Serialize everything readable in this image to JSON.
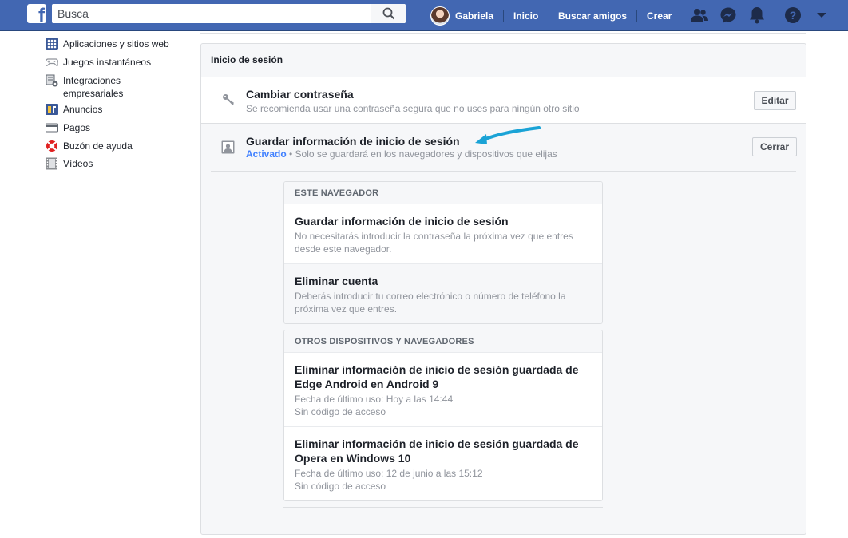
{
  "topbar": {
    "search_placeholder": "Busca",
    "user_name": "Gabriela",
    "nav_home": "Inicio",
    "nav_find_friends": "Buscar amigos",
    "nav_create": "Crear",
    "icons": [
      "friend-requests-icon",
      "messenger-icon",
      "notifications-icon",
      "help-icon",
      "account-menu-icon"
    ]
  },
  "sidebar": {
    "items": [
      {
        "label": "Aplicaciones y sitios web",
        "icon": "apps-icon"
      },
      {
        "label": "Juegos instantáneos",
        "icon": "gamepad-icon"
      },
      {
        "label": "Integraciones empresariales",
        "icon": "business-integrations-icon"
      },
      {
        "label": "Anuncios",
        "icon": "ads-icon"
      },
      {
        "label": "Pagos",
        "icon": "payments-icon"
      },
      {
        "label": "Buzón de ayuda",
        "icon": "support-inbox-icon"
      },
      {
        "label": "Vídeos",
        "icon": "videos-icon"
      }
    ]
  },
  "login_section": {
    "title": "Inicio de sesión",
    "change_password": {
      "title": "Cambiar contraseña",
      "subtitle": "Se recomienda usar una contraseña segura que no uses para ningún otro sitio",
      "button": "Editar"
    },
    "save_login": {
      "title": "Guardar información de inicio de sesión",
      "status": "Activado",
      "subtitle": " • Solo se guardará en los navegadores y dispositivos que elijas",
      "button": "Cerrar"
    },
    "this_browser": {
      "header": "ESTE NAVEGADOR",
      "items": [
        {
          "title": "Guardar información de inicio de sesión",
          "desc": "No necesitarás introducir la contraseña la próxima vez que entres desde este navegador."
        },
        {
          "title": "Eliminar cuenta",
          "desc": "Deberás introducir tu correo electrónico o número de teléfono la próxima vez que entres."
        }
      ]
    },
    "other_devices": {
      "header": "OTROS DISPOSITIVOS Y NAVEGADORES",
      "items": [
        {
          "title": "Eliminar información de inicio de sesión guardada de Edge Android en Android 9",
          "last_used": "Fecha de último uso: Hoy a las 14:44",
          "passcode": "Sin código de acceso"
        },
        {
          "title": "Eliminar información de inicio de sesión guardada de Opera en Windows 10",
          "last_used": "Fecha de último uso: 12 de junio a las 15:12",
          "passcode": "Sin código de acceso"
        }
      ]
    }
  },
  "colors": {
    "brand": "#4267b2",
    "active": "#4080ff",
    "annotation_arrow": "#1aa3d6"
  }
}
